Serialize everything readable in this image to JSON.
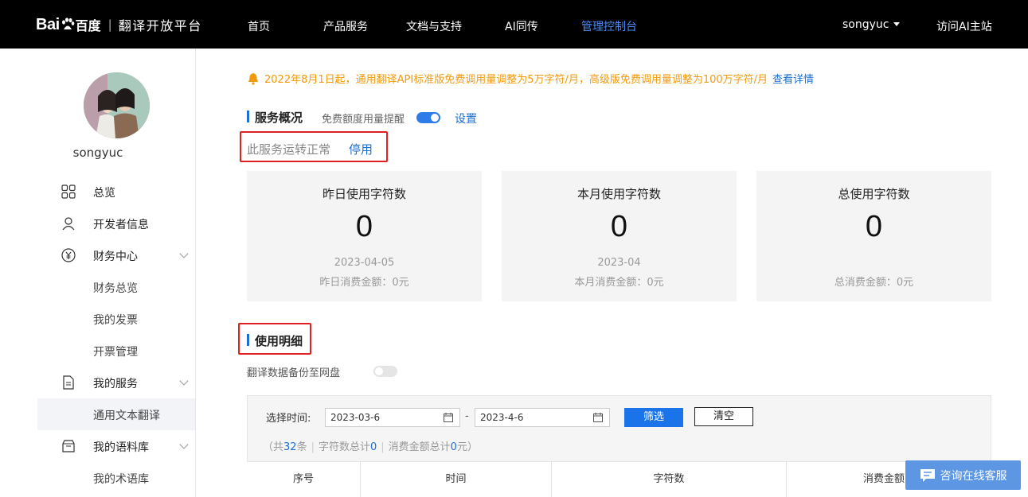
{
  "topbar": {
    "logo_latin": "Bai",
    "logo_cn": "百度",
    "platform": "翻译开放平台",
    "nav": [
      "首页",
      "产品服务",
      "文档与支持",
      "AI同传",
      "管理控制台"
    ],
    "active_nav": "管理控制台",
    "username": "songyuc",
    "visit": "访问AI主站"
  },
  "sidebar": {
    "username": "songyuc",
    "items": [
      {
        "label": "总览",
        "icon": "grid-icon"
      },
      {
        "label": "开发者信息",
        "icon": "user-icon"
      },
      {
        "label": "财务中心",
        "icon": "yuan-icon"
      },
      {
        "label": "财务总览"
      },
      {
        "label": "我的发票"
      },
      {
        "label": "开票管理"
      },
      {
        "label": "我的服务",
        "icon": "document-icon"
      },
      {
        "label": "通用文本翻译"
      },
      {
        "label": "我的语料库",
        "icon": "box-icon"
      },
      {
        "label": "我的术语库"
      }
    ]
  },
  "notice": {
    "text": "2022年8月1日起，通用翻译API标准版免费调用量调整为5万字符/月，高级版免费调用量调整为100万字符/月",
    "link": "查看详情"
  },
  "overview": {
    "title": "服务概况",
    "quota_label": "免费额度用量提醒",
    "quota_toggle": true,
    "setting": "设置",
    "status": "此服务运转正常",
    "stop": "停用"
  },
  "cards": [
    {
      "title": "昨日使用字符数",
      "value": "0",
      "date": "2023-04-05",
      "money": "昨日消费金额：0元"
    },
    {
      "title": "本月使用字符数",
      "value": "0",
      "date": "2023-04",
      "money": "本月消费金额：0元"
    },
    {
      "title": "总使用字符数",
      "value": "0",
      "date": "",
      "money": "总消费金额：0元"
    }
  ],
  "detail": {
    "title": "使用明细",
    "backup_label": "翻译数据备份至网盘",
    "backup_toggle": false,
    "time_label": "选择时间:",
    "start_date": "2023-03-6",
    "end_date": "2023-4-6",
    "dash": "-",
    "filter_btn": "筛选",
    "clear_btn": "清空",
    "summary": {
      "prefix": "（共",
      "count": "32",
      "count_suffix": "条",
      "chars_label": "字符数总计",
      "chars": "0",
      "money_label": "消费金额总计",
      "money": "0",
      "money_suffix": "元）"
    },
    "columns": [
      "序号",
      "时间",
      "字符数",
      "消费金额（"
    ]
  },
  "chat": {
    "label": "咨询在线客服"
  },
  "colors": {
    "accent": "#1a6fd1",
    "notice": "#f29a0c",
    "highlight_box": "#e02020"
  }
}
